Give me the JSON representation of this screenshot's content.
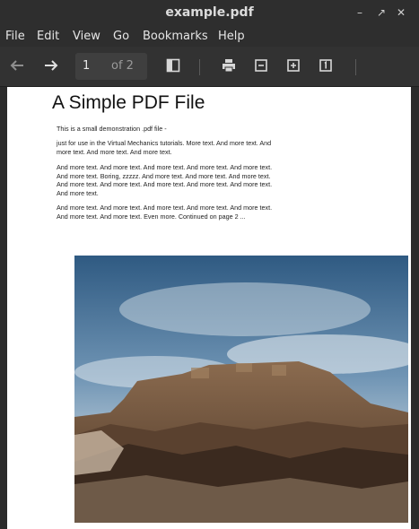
{
  "window": {
    "title": "example.pdf"
  },
  "menu": [
    "File",
    "Edit",
    "View",
    "Go",
    "Bookmarks",
    "Help"
  ],
  "toolbar": {
    "current_page": "1",
    "total_pages": "of 2"
  },
  "document": {
    "title": "A Simple PDF File",
    "paragraphs": [
      "This is a small demonstration .pdf file -",
      "just for use in the Virtual Mechanics tutorials. More text. And more text. And more text. And more text. And more text.",
      "And more text. And more text. And more text. And more text. And more text. And more text. Boring, zzzzz. And more text. And more text. And more text. And more text. And more text. And more text. And more text. And more text. And more text.",
      "And more text. And more text. And more text. And more text. And more text. And more text. And more text. Even more. Continued on page 2 ..."
    ]
  },
  "colors": {
    "window_bg": "#2e2e2e",
    "toolbar_bg": "#323232",
    "page_bg": "#ffffff",
    "sky": "#3f6f97",
    "ruin": "#8a6a4e"
  }
}
